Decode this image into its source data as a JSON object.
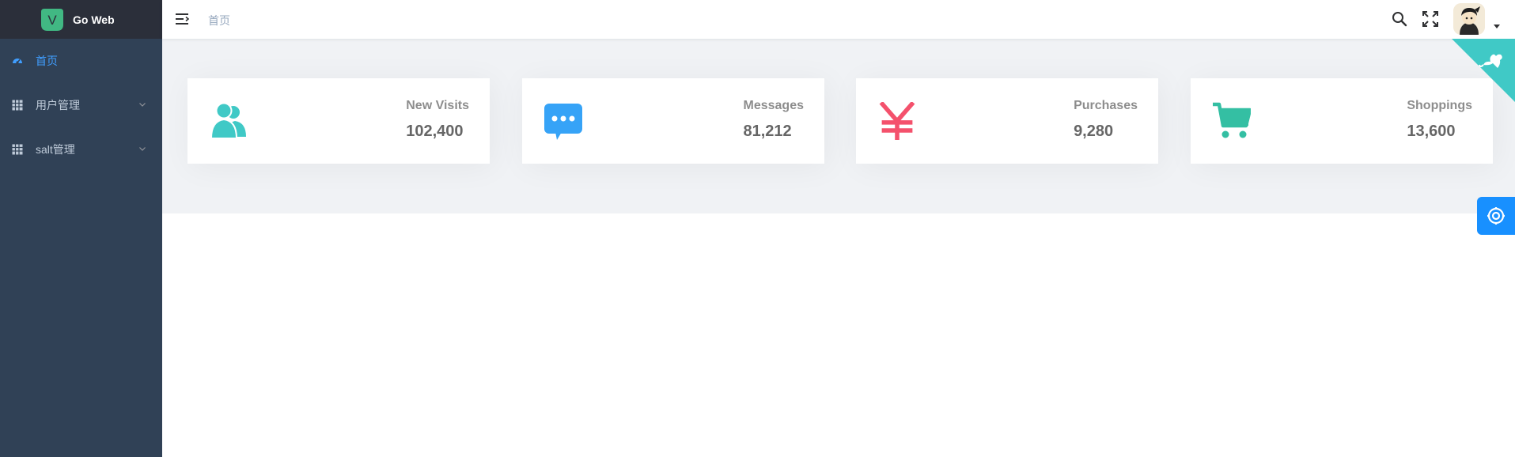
{
  "app": {
    "title": "Go Web",
    "logo_letter": "V"
  },
  "sidebar": {
    "items": [
      {
        "label": "首页",
        "icon": "dashboard-icon",
        "active": true
      },
      {
        "label": "用户管理",
        "icon": "table-icon",
        "expandable": true
      },
      {
        "label": "salt管理",
        "icon": "table-icon",
        "expandable": true
      }
    ]
  },
  "navbar": {
    "breadcrumb": "首页",
    "icons": [
      "hamburger-icon",
      "search-icon",
      "fullscreen-icon",
      "avatar",
      "caret-down-icon"
    ]
  },
  "cards": [
    {
      "label": "New Visits",
      "value": "102,400",
      "icon": "peoples-icon",
      "color": "#40c9c6"
    },
    {
      "label": "Messages",
      "value": "81,212",
      "icon": "message-icon",
      "color": "#36a3f7"
    },
    {
      "label": "Purchases",
      "value": "9,280",
      "icon": "money-icon",
      "color": "#f4516c"
    },
    {
      "label": "Shoppings",
      "value": "13,600",
      "icon": "shopping-icon",
      "color": "#34bfa3"
    }
  ],
  "colors": {
    "sidebar_bg": "#304156",
    "logo_bg": "#2b2f3a",
    "menu_active": "#409eff",
    "panel_bg": "#f0f2f5",
    "github_corner": "#40c9c6",
    "settings_tab": "#1890ff"
  }
}
